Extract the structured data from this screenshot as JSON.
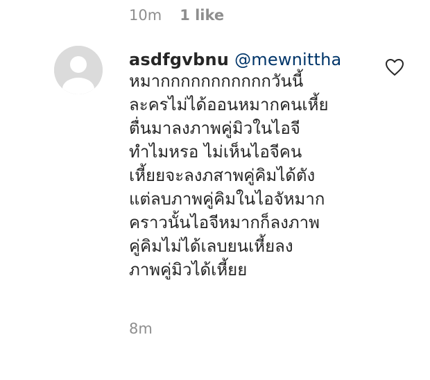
{
  "previous_comment": {
    "timestamp": "10m",
    "likes": "1 like"
  },
  "comment": {
    "avatar_icon": "default-avatar-icon",
    "username": "asdfgvbnu",
    "mention": "@mewnittha",
    "lines": [
      "หมากกกกกกกกกกกวันนี้",
      "ละครไม่ได้ออนหมากคนเหี้ย",
      "ตื่นมาลงภาพคู่มิวในไอจี",
      "ทำไมหรอ ไม่เห็นไอจีคน",
      "เหี้ยยจะลงภสาพคู่คิมได้ตัง",
      "แต่ลบภาพคู่คิมในไอจัหมาก",
      "คราวนั้นไอจีหมากก็ลงภาพ",
      "คู่คิมไม่ได้เลบยนเหี้ยลง",
      "ภาพคู่มิวได้เหี้ยย"
    ],
    "timestamp": "8m",
    "like_icon": "heart-outline-icon"
  },
  "colors": {
    "text": "#262626",
    "secondary": "#8e8e8e",
    "mention": "#003569",
    "avatar_bg": "#dbdbdb"
  }
}
